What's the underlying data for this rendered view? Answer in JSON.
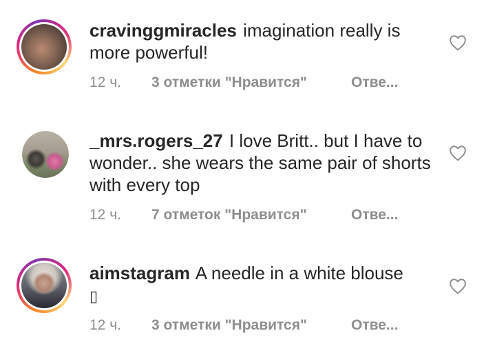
{
  "comments": [
    {
      "username": "cravinggmiracles",
      "text": "imagination really is more powerful!",
      "time": "12 ч.",
      "likes": "3 отметки \"Нравится\"",
      "reply": "Отве..."
    },
    {
      "username": "_mrs.rogers_27",
      "text": "I love Britt.. but I have to wonder.. she wears the same pair of shorts with every top",
      "time": "12 ч.",
      "likes": "7 отметок \"Нравится\"",
      "reply": "Отве..."
    },
    {
      "username": "aimstagram",
      "text": "A needle in a white blouse",
      "emoji": "▯",
      "time": "12 ч.",
      "likes": "3 отметки \"Нравится\"",
      "reply": "Отве..."
    }
  ],
  "icons": {
    "like": "heart-outline-icon"
  },
  "colors": {
    "text": "#262626",
    "meta": "#8e8e8e",
    "story_ring_start": "#f58529",
    "story_ring_end": "#dd2a7b"
  }
}
